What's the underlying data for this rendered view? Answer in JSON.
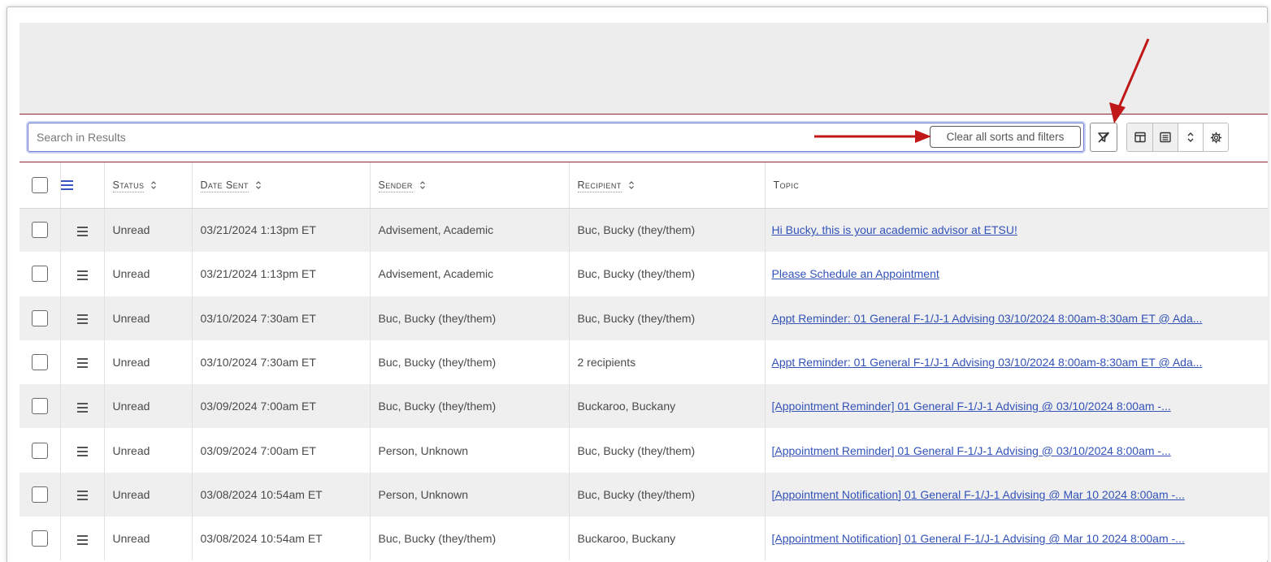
{
  "search": {
    "placeholder": "Search in Results"
  },
  "toolbar": {
    "clear_label": "Clear all sorts and filters",
    "icons": [
      "filter-off-icon",
      "column-layout-icon",
      "list-view-icon",
      "sort-icon",
      "settings-icon"
    ]
  },
  "table": {
    "headers": {
      "status": "Status",
      "date_sent": "Date Sent",
      "sender": "Sender",
      "recipient": "Recipient",
      "topic": "Topic"
    },
    "rows": [
      {
        "status": "Unread",
        "date_sent": "03/21/2024 1:13pm ET",
        "sender": "Advisement, Academic",
        "recipient": "Buc, Bucky (they/them)",
        "topic": "Hi Bucky, this is your academic advisor at ETSU!"
      },
      {
        "status": "Unread",
        "date_sent": "03/21/2024 1:13pm ET",
        "sender": "Advisement, Academic",
        "recipient": "Buc, Bucky (they/them)",
        "topic": "Please Schedule an Appointment"
      },
      {
        "status": "Unread",
        "date_sent": "03/10/2024 7:30am ET",
        "sender": "Buc, Bucky (they/them)",
        "recipient": "Buc, Bucky (they/them)",
        "topic": "Appt Reminder: 01 General F-1/J-1 Advising 03/10/2024 8:00am-8:30am ET @ Ada..."
      },
      {
        "status": "Unread",
        "date_sent": "03/10/2024 7:30am ET",
        "sender": "Buc, Bucky (they/them)",
        "recipient": "2 recipients",
        "topic": "Appt Reminder: 01 General F-1/J-1 Advising 03/10/2024 8:00am-8:30am ET @ Ada..."
      },
      {
        "status": "Unread",
        "date_sent": "03/09/2024 7:00am ET",
        "sender": "Buc, Bucky (they/them)",
        "recipient": "Buckaroo, Buckany",
        "topic": "[Appointment Reminder] 01 General F-1/J-1 Advising @ 03/10/2024 8:00am -..."
      },
      {
        "status": "Unread",
        "date_sent": "03/09/2024 7:00am ET",
        "sender": "Person, Unknown",
        "recipient": "Buc, Bucky (they/them)",
        "topic": "[Appointment Reminder] 01 General F-1/J-1 Advising @ 03/10/2024 8:00am -..."
      },
      {
        "status": "Unread",
        "date_sent": "03/08/2024 10:54am ET",
        "sender": "Person, Unknown",
        "recipient": "Buc, Bucky (they/them)",
        "topic": "[Appointment Notification] 01 General F-1/J-1 Advising @ Mar 10 2024 8:00am -..."
      },
      {
        "status": "Unread",
        "date_sent": "03/08/2024 10:54am ET",
        "sender": "Buc, Bucky (they/them)",
        "recipient": "Buckaroo, Buckany",
        "topic": "[Appointment Notification] 01 General F-1/J-1 Advising @ Mar 10 2024 8:00am -..."
      }
    ]
  },
  "colors": {
    "accent": "#8a2332",
    "link": "#3252b8",
    "arrow": "#c01818"
  }
}
